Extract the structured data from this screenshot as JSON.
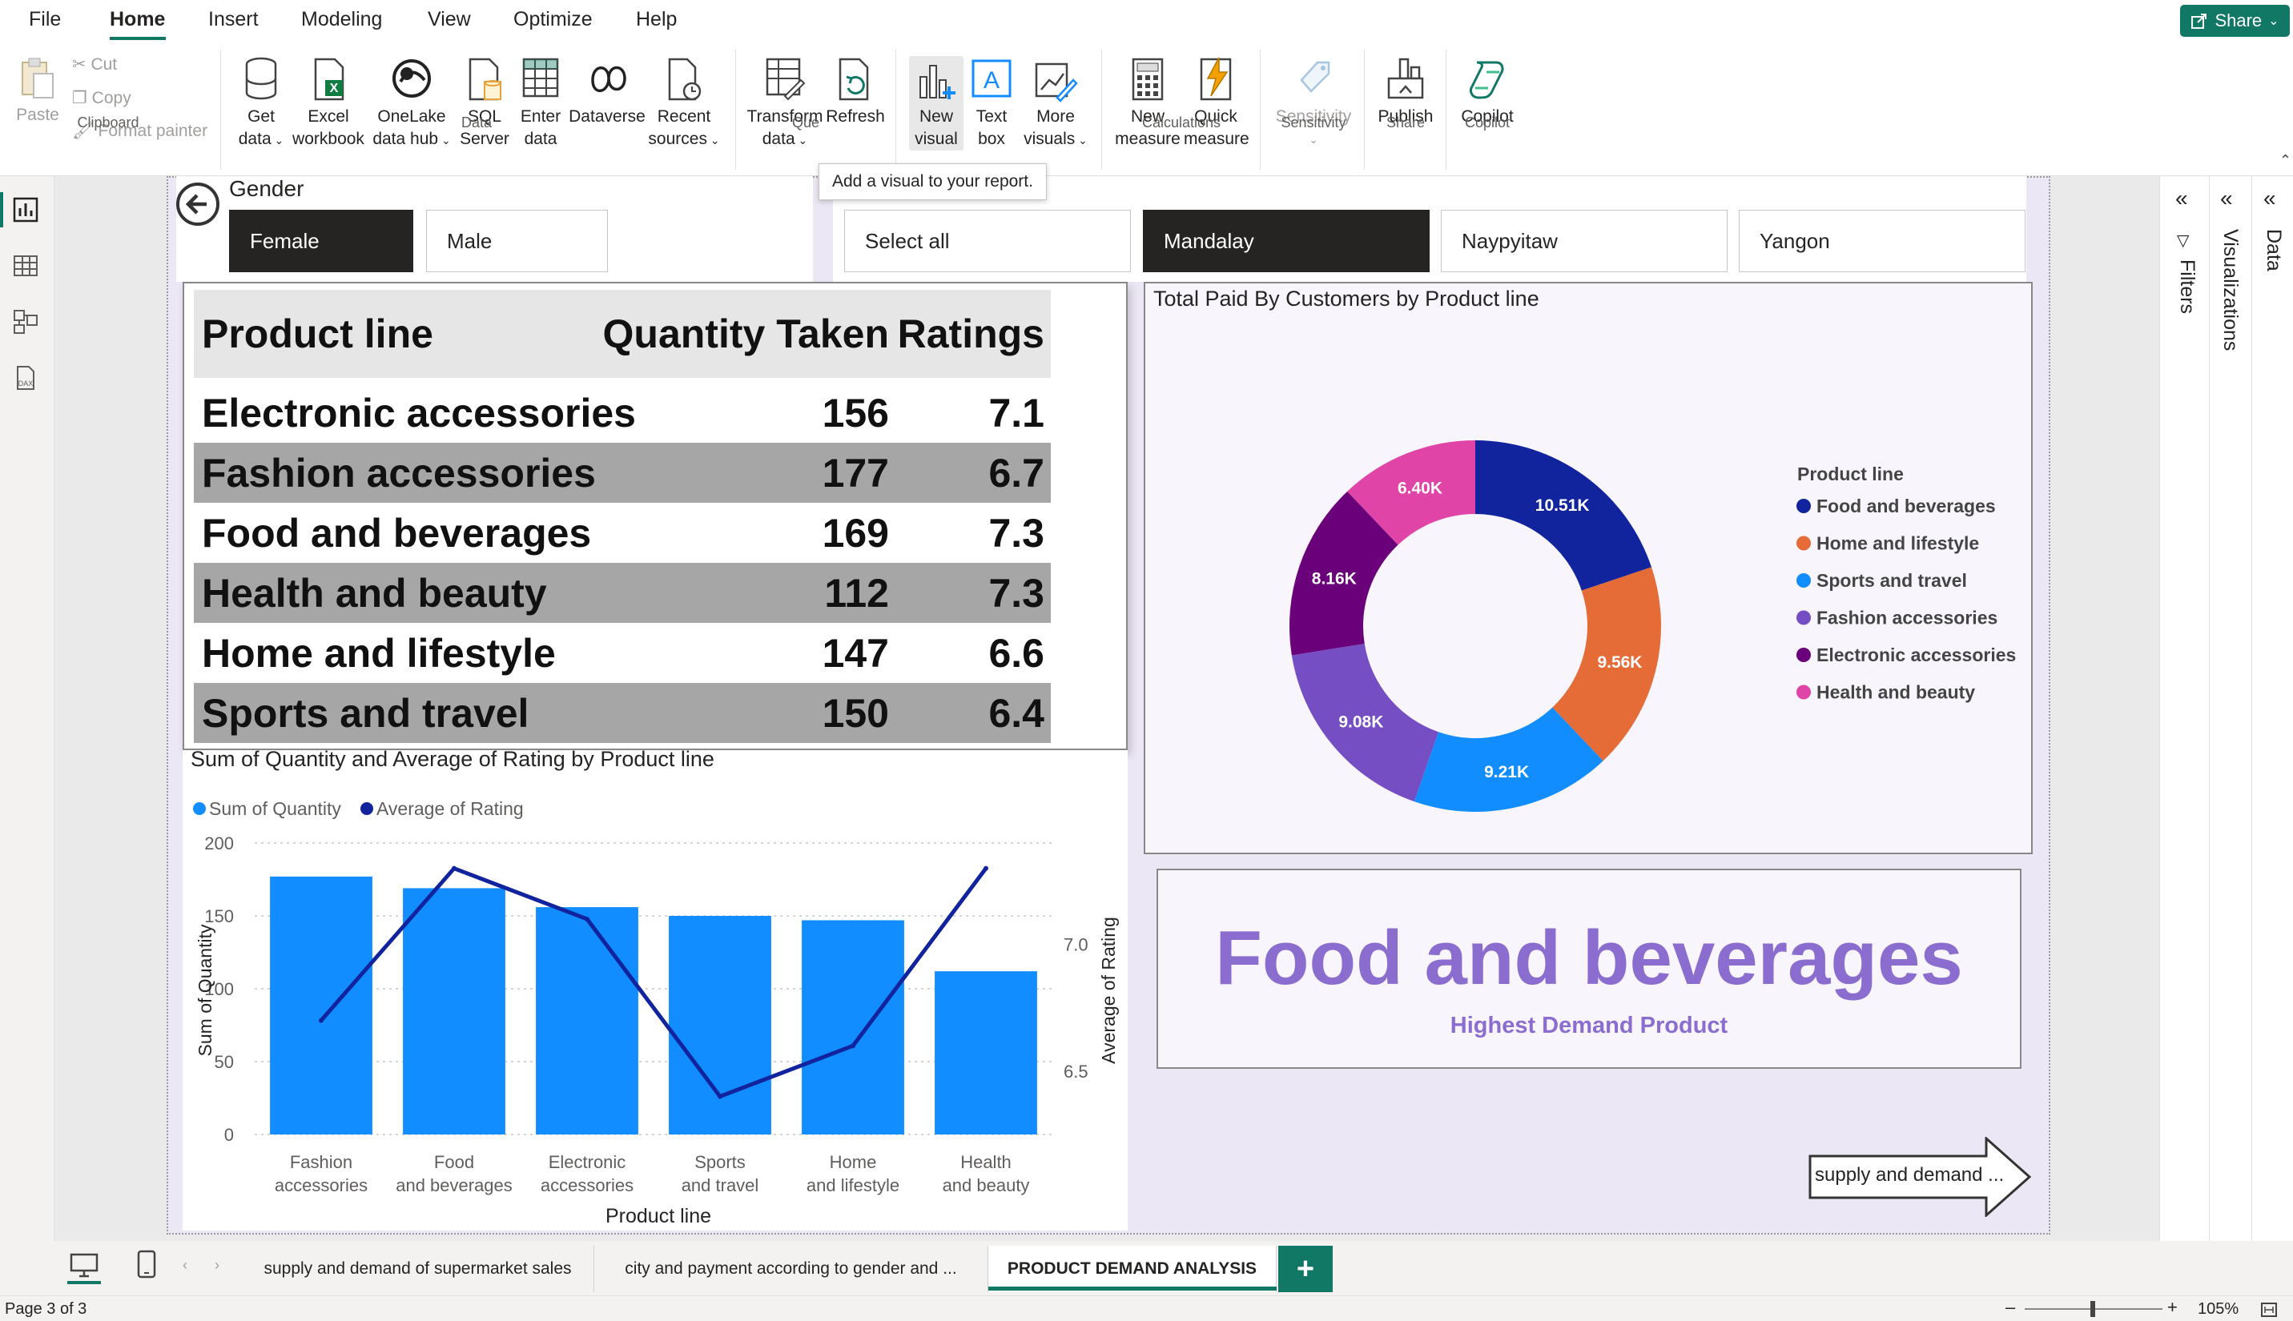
{
  "menubar": {
    "items": [
      "File",
      "Home",
      "Insert",
      "Modeling",
      "View",
      "Optimize",
      "Help"
    ],
    "active": "Home",
    "share_label": "Share"
  },
  "ribbon": {
    "clipboard": {
      "paste": "Paste",
      "cut": "Cut",
      "copy": "Copy",
      "format_painter": "Format painter",
      "group": "Clipboard"
    },
    "data": {
      "get_data": [
        "Get",
        "data"
      ],
      "excel": [
        "Excel",
        "workbook"
      ],
      "onelake": [
        "OneLake",
        "data hub"
      ],
      "sql": [
        "SQL",
        "Server"
      ],
      "enter": [
        "Enter",
        "data"
      ],
      "dataverse": [
        "Dataverse"
      ],
      "recent": [
        "Recent",
        "sources"
      ],
      "group": "Data"
    },
    "queries": {
      "transform": [
        "Transform",
        "data"
      ],
      "refresh": [
        "Refresh"
      ],
      "group": "Que"
    },
    "insert": {
      "new_visual": [
        "New",
        "visual"
      ],
      "text_box": [
        "Text",
        "box"
      ],
      "more_visuals": [
        "More",
        "visuals"
      ]
    },
    "calculations": {
      "new_measure": [
        "New",
        "measure"
      ],
      "quick_measure": [
        "Quick",
        "measure"
      ],
      "group": "Calculations"
    },
    "sensitivity": {
      "label": "Sensitivity",
      "group": "Sensitivity"
    },
    "share": {
      "publish": "Publish",
      "group": "Share"
    },
    "copilot": {
      "label": "Copilot",
      "group": "Copilot"
    },
    "tooltip": "Add a visual to your report."
  },
  "slicer_gender": {
    "title": "Gender",
    "options": [
      "Female",
      "Male"
    ],
    "selected": "Female"
  },
  "slicer_city": {
    "options": [
      "Select all",
      "Mandalay",
      "Naypyitaw",
      "Yangon"
    ],
    "selected": "Mandalay"
  },
  "table": {
    "headers": [
      "Product line",
      "Quantity Taken",
      "Ratings"
    ],
    "rows": [
      [
        "Electronic accessories",
        "156",
        "7.1"
      ],
      [
        "Fashion accessories",
        "177",
        "6.7"
      ],
      [
        "Food and beverages",
        "169",
        "7.3"
      ],
      [
        "Health and beauty",
        "112",
        "7.3"
      ],
      [
        "Home and lifestyle",
        "147",
        "6.6"
      ],
      [
        "Sports and travel",
        "150",
        "6.4"
      ]
    ]
  },
  "donut": {
    "title": "Total Paid By Customers by Product line",
    "legend_title": "Product line"
  },
  "kpi": {
    "value": "Food and beverages",
    "label": "Highest Demand Product"
  },
  "nav_button": {
    "label": "supply and demand ..."
  },
  "tabs": [
    "supply and demand of supermarket sales",
    "city and payment according to gender and ...",
    "PRODUCT DEMAND ANALYSIS"
  ],
  "active_tab": "PRODUCT DEMAND ANALYSIS",
  "status": {
    "page": "Page 3 of 3",
    "zoom": "105%"
  },
  "panes": {
    "filters": "Filters",
    "visualizations": "Visualizations",
    "data": "Data"
  },
  "colors": {
    "accent": "#117865",
    "bar": "#118dff",
    "line": "#12239e",
    "kpi": "#8b6ccf"
  },
  "icons": [
    "paste-icon",
    "cut-icon",
    "copy-icon",
    "format-painter-icon",
    "database-icon",
    "excel-icon",
    "onelake-icon",
    "sql-icon",
    "table-icon",
    "dataverse-icon",
    "recent-icon",
    "transform-icon",
    "refresh-icon",
    "new-visual-icon",
    "text-box-icon",
    "more-visuals-icon",
    "new-measure-icon",
    "quick-measure-icon",
    "sensitivity-icon",
    "publish-icon",
    "copilot-icon",
    "back-arrow-icon"
  ],
  "chart_data": [
    {
      "type": "bar",
      "title": "Sum of Quantity and Average of Rating by Product line",
      "xlabel": "Product line",
      "ylabel": "Sum of Quantity",
      "y2label": "Average of Rating",
      "categories": [
        "Fashion accessories",
        "Food and beverages",
        "Electronic accessories",
        "Sports and travel",
        "Home and lifestyle",
        "Health and beauty"
      ],
      "series": [
        {
          "name": "Sum of Quantity",
          "kind": "bar",
          "values": [
            177,
            169,
            156,
            150,
            147,
            112
          ]
        },
        {
          "name": "Average of Rating",
          "kind": "line",
          "axis": "y2",
          "values": [
            6.7,
            7.3,
            7.1,
            6.4,
            6.6,
            7.3
          ]
        }
      ],
      "ylim": [
        0,
        200
      ],
      "yticks": [
        0,
        50,
        100,
        150,
        200
      ],
      "y2lim": [
        6.25,
        7.4
      ],
      "y2ticks": [
        6.5,
        7.0
      ],
      "legend": "top-left",
      "grid": true
    },
    {
      "type": "pie",
      "variant": "donut",
      "title": "Total Paid By Customers by Product line",
      "legend": "right",
      "legend_title": "Product line",
      "slices": [
        {
          "name": "Food and beverages",
          "value": 10.51,
          "label": "10.51K",
          "color": "#12239e"
        },
        {
          "name": "Home and lifestyle",
          "value": 9.56,
          "label": "9.56K",
          "color": "#e66c37"
        },
        {
          "name": "Sports and travel",
          "value": 9.21,
          "label": "9.21K",
          "color": "#118dff"
        },
        {
          "name": "Fashion accessories",
          "value": 9.08,
          "label": "9.08K",
          "color": "#744ec2"
        },
        {
          "name": "Electronic accessories",
          "value": 8.16,
          "label": "8.16K",
          "color": "#6b007b"
        },
        {
          "name": "Health and beauty",
          "value": 6.4,
          "label": "6.40K",
          "color": "#e044a7"
        }
      ]
    }
  ]
}
